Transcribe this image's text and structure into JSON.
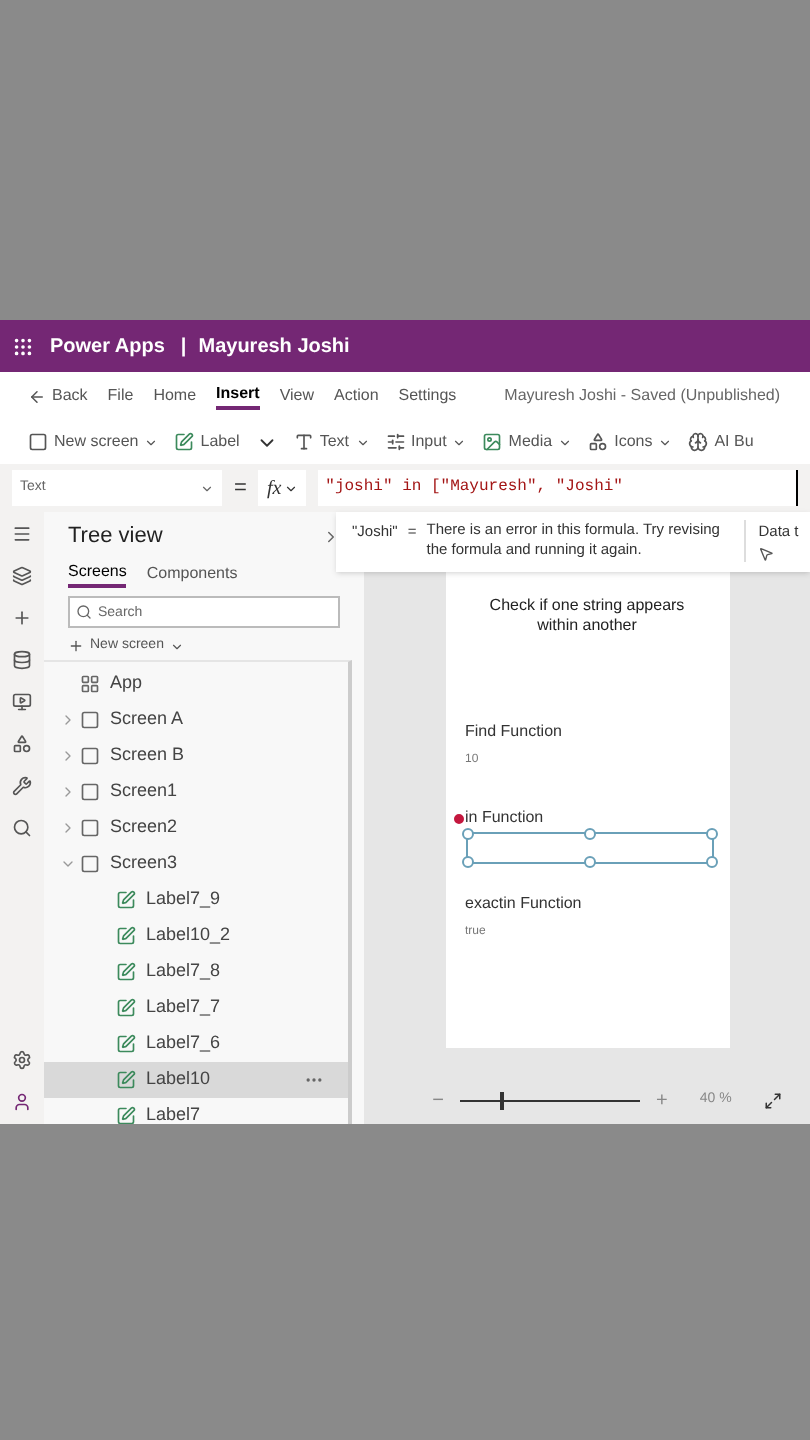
{
  "title_bar": {
    "app": "Power Apps",
    "separator": "|",
    "user": "Mayuresh Joshi"
  },
  "menu": {
    "back": "Back",
    "tabs": [
      {
        "label": "File",
        "selected": false
      },
      {
        "label": "Home",
        "selected": false
      },
      {
        "label": "Insert",
        "selected": true
      },
      {
        "label": "View",
        "selected": false
      },
      {
        "label": "Action",
        "selected": false
      },
      {
        "label": "Settings",
        "selected": false
      }
    ],
    "status": "Mayuresh Joshi - Saved (Unpublished)"
  },
  "toolbar": [
    {
      "kind": "screen",
      "label": "New screen"
    },
    {
      "kind": "label",
      "label": "Label"
    },
    {
      "kind": "expander"
    },
    {
      "kind": "text",
      "label": "Text"
    },
    {
      "kind": "input",
      "label": "Input"
    },
    {
      "kind": "media",
      "label": "Media"
    },
    {
      "kind": "icons",
      "label": "Icons"
    },
    {
      "kind": "ai",
      "label": "AI Bu"
    }
  ],
  "formula_bar": {
    "property": "Text",
    "equals": "=",
    "fx": "fx",
    "formula": "\"joshi\" in [\"Mayuresh\", \"Joshi\""
  },
  "tooltip": {
    "value": "\"Joshi\"",
    "equals": "=",
    "message": "There is an error in this formula. Try revising the formula and running it again.",
    "side_tab": "Data t"
  },
  "tree_view": {
    "title": "Tree view",
    "tabs": [
      {
        "label": "Screens",
        "selected": true
      },
      {
        "label": "Components",
        "selected": false
      }
    ],
    "search": {
      "placeholder": "Search"
    },
    "new_screen": "New screen",
    "items": [
      {
        "kind": "app",
        "label": "App",
        "selected": false
      },
      {
        "kind": "screen",
        "label": "Screen A",
        "expanded": false,
        "selected": false
      },
      {
        "kind": "screen",
        "label": "Screen B",
        "expanded": false,
        "selected": false
      },
      {
        "kind": "screen",
        "label": "Screen1",
        "expanded": false,
        "selected": false
      },
      {
        "kind": "screen",
        "label": "Screen2",
        "expanded": false,
        "selected": false
      },
      {
        "kind": "screen",
        "label": "Screen3",
        "expanded": true,
        "selected": false,
        "children": [
          {
            "kind": "label",
            "label": "Label7_9",
            "selected": false
          },
          {
            "kind": "label",
            "label": "Label10_2",
            "selected": false
          },
          {
            "kind": "label",
            "label": "Label7_8",
            "selected": false
          },
          {
            "kind": "label",
            "label": "Label7_7",
            "selected": false
          },
          {
            "kind": "label",
            "label": "Label7_6",
            "selected": false
          },
          {
            "kind": "label",
            "label": "Label10",
            "selected": true
          },
          {
            "kind": "label",
            "label": "Label7",
            "selected": false
          }
        ]
      }
    ]
  },
  "canvas": {
    "heading": "Check if one string appears within another",
    "controls": [
      {
        "kind": "label",
        "text": "Find Function",
        "error": false
      },
      {
        "kind": "value",
        "text": "10"
      },
      {
        "kind": "label",
        "text": "in Function",
        "error": true
      },
      {
        "kind": "selected_empty"
      },
      {
        "kind": "label",
        "text": "exactin Function",
        "error": false
      },
      {
        "kind": "value",
        "text": "true"
      }
    ]
  },
  "zoom": {
    "minus": "−",
    "plus": "+",
    "level": 0.22,
    "reading": "40 %"
  }
}
